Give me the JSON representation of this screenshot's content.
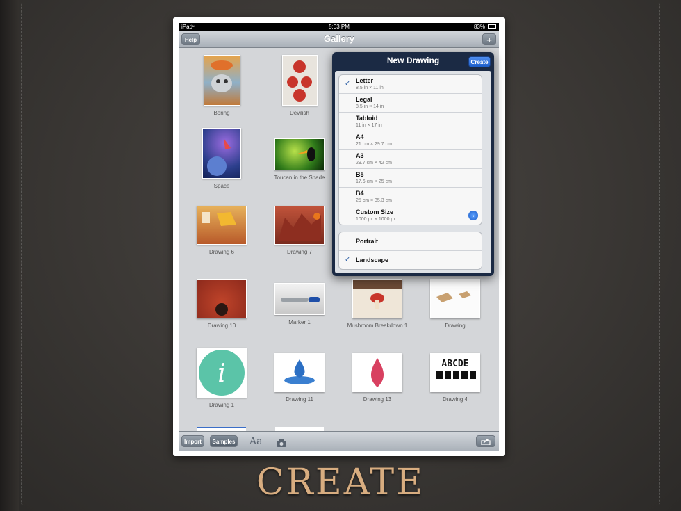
{
  "status": {
    "carrier": "iPad",
    "time": "5:03 PM",
    "battery": "83%"
  },
  "nav": {
    "title": "Gallery",
    "help": "Help",
    "add": "+"
  },
  "gallery": [
    {
      "name": "Boring",
      "thumb": "boring"
    },
    {
      "name": "Devilish",
      "thumb": "devilish"
    },
    {
      "name": "Space",
      "thumb": "space"
    },
    {
      "name": "Toucan in the Shade",
      "thumb": "toucan"
    },
    {
      "name": "Drawing 6",
      "thumb": "d6"
    },
    {
      "name": "Drawing 7",
      "thumb": "d7"
    },
    {
      "name": "Drawing 10",
      "thumb": "d10"
    },
    {
      "name": "Marker 1",
      "thumb": "marker"
    },
    {
      "name": "Mushroom Breakdown 1",
      "thumb": "mushroom"
    },
    {
      "name": "Drawing",
      "thumb": "boxes"
    },
    {
      "name": "Drawing 1",
      "thumb": "info"
    },
    {
      "name": "Drawing 11",
      "thumb": "d11"
    },
    {
      "name": "Drawing 13",
      "thumb": "d13"
    },
    {
      "name": "Drawing 4",
      "thumb": "abcde"
    }
  ],
  "popover": {
    "title": "New Drawing",
    "create": "Create",
    "sizes": [
      {
        "name": "Letter",
        "dims": "8.5 in × 11 in",
        "checked": true
      },
      {
        "name": "Legal",
        "dims": "8.5 in × 14 in",
        "checked": false
      },
      {
        "name": "Tabloid",
        "dims": "11 in × 17 in",
        "checked": false
      },
      {
        "name": "A4",
        "dims": "21 cm × 29.7 cm",
        "checked": false
      },
      {
        "name": "A3",
        "dims": "29.7 cm × 42 cm",
        "checked": false
      },
      {
        "name": "B5",
        "dims": "17.6 cm × 25 cm",
        "checked": false
      },
      {
        "name": "B4",
        "dims": "25 cm × 35.3 cm",
        "checked": false
      },
      {
        "name": "Custom Size",
        "dims": "1000 px × 1000 px",
        "checked": false,
        "detail": true
      }
    ],
    "orientation": [
      {
        "name": "Portrait",
        "checked": false
      },
      {
        "name": "Landscape",
        "checked": true
      }
    ],
    "checkmark": "✓",
    "detail_glyph": "›"
  },
  "toolbar": {
    "import": "Import",
    "samples": "Samples",
    "font": "Aa"
  },
  "slide_title": "CREATE",
  "colors": {
    "accent": "#2d6bd5",
    "title": "#d8ad80"
  }
}
